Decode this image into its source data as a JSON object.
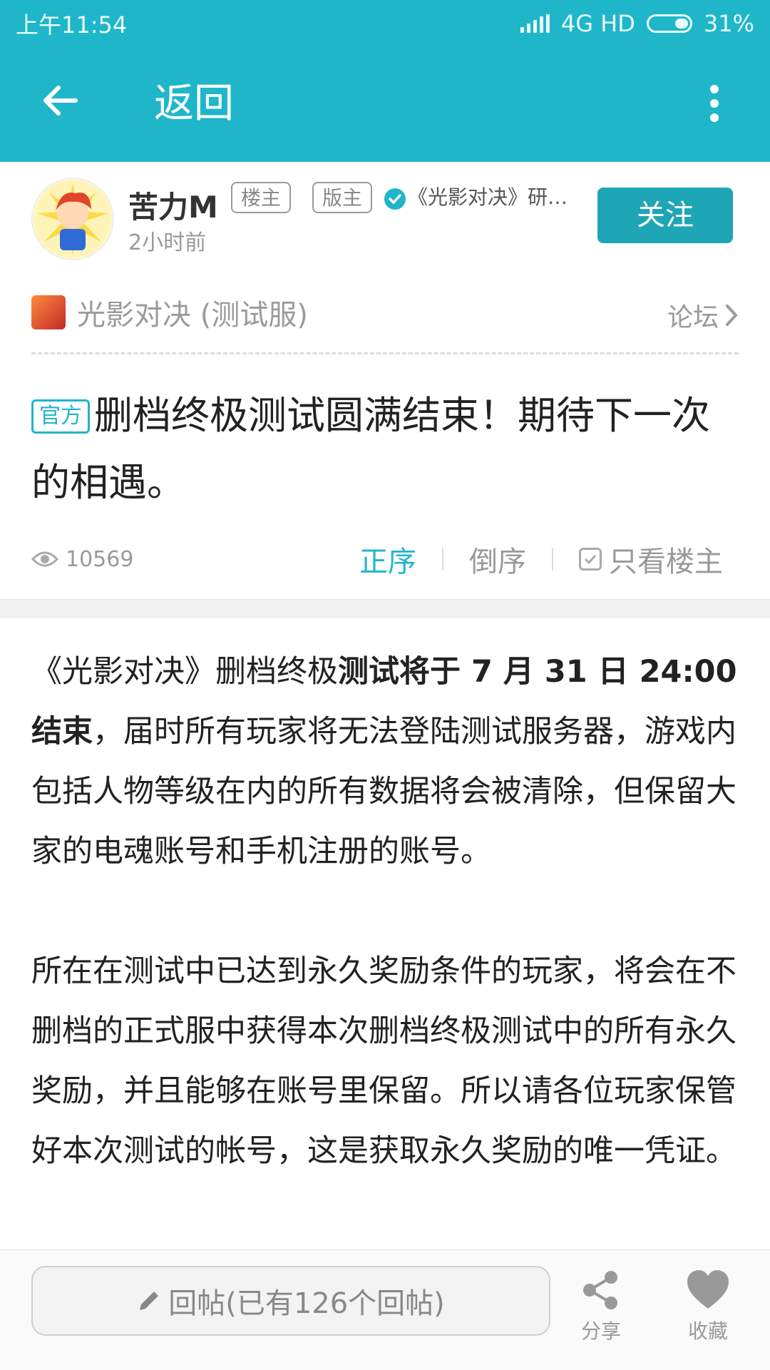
{
  "status_bar": {
    "time": "上午11:54",
    "network": "4G HD",
    "battery": "31%"
  },
  "app_bar": {
    "title": "返回"
  },
  "author": {
    "name": "苦力M",
    "tags": [
      "楼主",
      "版主"
    ],
    "affiliation": "《光影对决》研发...",
    "time": "2小时前",
    "follow_label": "关注"
  },
  "forum": {
    "name": "光影对决 (测试服)",
    "link_label": "论坛"
  },
  "post": {
    "badge": "官方",
    "title": "删档终极测试圆满结束！期待下一次的相遇。",
    "views": "10569",
    "sort_options": {
      "asc": "正序",
      "desc": "倒序",
      "op_only": "只看楼主"
    },
    "paragraph1_prefix": "《光影对决》删档终极",
    "paragraph1_bold": "测试将于 7 月 31 日 24:00 结束",
    "paragraph1_suffix": "，届时所有玩家将无法登陆测试服务器，游戏内包括人物等级在内的所有数据将会被清除，但保留大家的电魂账号和手机注册的账号。",
    "paragraph2": "所在在测试中已达到永久奖励条件的玩家，将会在不删档的正式服中获得本次删档终极测试中的所有永久奖励，并且能够在账号里保留。所以请各位玩家保管好本次测试的帐号，这是获取永久奖励的唯一凭证。"
  },
  "bottom_bar": {
    "reply_placeholder": "回帖(已有126个回帖)",
    "share_label": "分享",
    "favorite_label": "收藏"
  }
}
